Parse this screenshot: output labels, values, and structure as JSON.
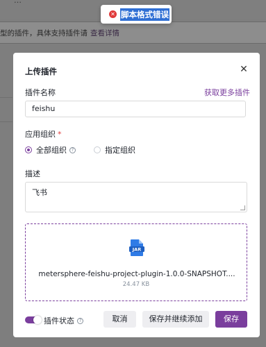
{
  "background": {
    "top_text": "…",
    "banner_text": "型的插件，具体支持插件请",
    "banner_link": "查看详情"
  },
  "toast": {
    "text": "脚本格式错误",
    "icon": "error-icon"
  },
  "modal": {
    "title": "上传插件",
    "close_icon": "close-icon",
    "plugin_name_label": "插件名称",
    "get_more_link": "获取更多插件",
    "plugin_name_value": "feishu",
    "org_label": "应用组织",
    "required_mark": "*",
    "org_options": [
      {
        "label": "全部组织",
        "selected": true
      },
      {
        "label": "指定组织",
        "selected": false
      }
    ],
    "desc_label": "描述",
    "desc_value": "飞书",
    "upload": {
      "file_icon": "jar-file-icon",
      "file_icon_text": "JAR",
      "file_name": "metersphere-feishu-project-plugin-1.0.0-SNAPSHOT....",
      "file_size": "24.47 KB"
    },
    "status_label": "插件状态",
    "status_enabled": true,
    "buttons": {
      "cancel": "取消",
      "save_continue": "保存并继续添加",
      "save": "保存"
    }
  },
  "colors": {
    "accent": "#7a3e9d",
    "error": "#e03a3a",
    "overlay": "#7e7e7e"
  }
}
